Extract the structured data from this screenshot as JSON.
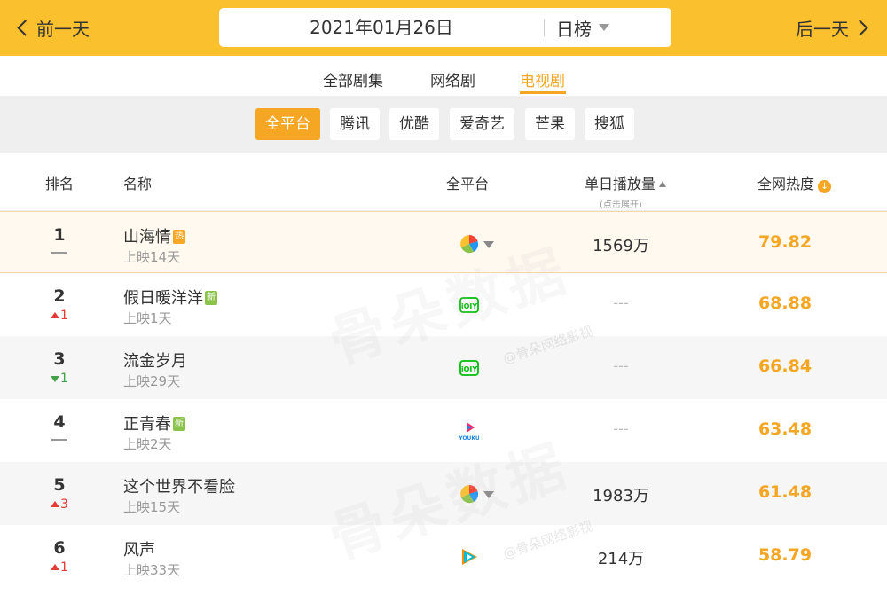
{
  "nav": {
    "prev_label": "前一天",
    "next_label": "后一天"
  },
  "date": {
    "value": "2021年01月26日",
    "range_label": "日榜"
  },
  "category_tabs": [
    {
      "label": "全部剧集"
    },
    {
      "label": "网络剧"
    },
    {
      "label": "电视剧",
      "active": true
    }
  ],
  "platform_filters": [
    {
      "label": "全平台",
      "active": true
    },
    {
      "label": "腾讯"
    },
    {
      "label": "优酷"
    },
    {
      "label": "爱奇艺"
    },
    {
      "label": "芒果"
    },
    {
      "label": "搜狐"
    }
  ],
  "table": {
    "headers": {
      "rank": "排名",
      "name": "名称",
      "platform": "全平台",
      "daily_plays": "单日播放量",
      "daily_plays_hint": "(点击展开)",
      "heat": "全网热度"
    },
    "rows": [
      {
        "rank": "1",
        "change": "",
        "direction": "",
        "title": "山海情",
        "badge": "热",
        "badge_type": "hot",
        "days": "上映14天",
        "platform_icon": "multi-platform-icon",
        "plays": "1569万",
        "heat": "79.82"
      },
      {
        "rank": "2",
        "change": "1",
        "direction": "up",
        "title": "假日暖洋洋",
        "badge": "新",
        "badge_type": "new",
        "days": "上映1天",
        "platform_icon": "iqiyi-icon",
        "plays": "---",
        "heat": "68.88"
      },
      {
        "rank": "3",
        "change": "1",
        "direction": "down",
        "title": "流金岁月",
        "badge": "",
        "badge_type": "",
        "days": "上映29天",
        "platform_icon": "iqiyi-icon",
        "plays": "---",
        "heat": "66.84"
      },
      {
        "rank": "4",
        "change": "",
        "direction": "",
        "title": "正青春",
        "badge": "新",
        "badge_type": "new",
        "days": "上映2天",
        "platform_icon": "youku-icon",
        "plays": "---",
        "heat": "63.48"
      },
      {
        "rank": "5",
        "change": "3",
        "direction": "up",
        "title": "这个世界不看脸",
        "badge": "",
        "badge_type": "",
        "days": "上映15天",
        "platform_icon": "multi-platform-icon",
        "plays": "1983万",
        "heat": "61.48"
      },
      {
        "rank": "6",
        "change": "1",
        "direction": "up",
        "title": "风声",
        "badge": "",
        "badge_type": "",
        "days": "上映33天",
        "platform_icon": "tencent-video-icon",
        "plays": "214万",
        "heat": "58.79"
      }
    ]
  },
  "watermark": {
    "main": "骨朵数据",
    "sub": "@骨朵网络影视"
  },
  "colors": {
    "topbar": "#fbc02d",
    "accent": "#f5a623",
    "up": "#e53935",
    "down": "#43a047"
  }
}
